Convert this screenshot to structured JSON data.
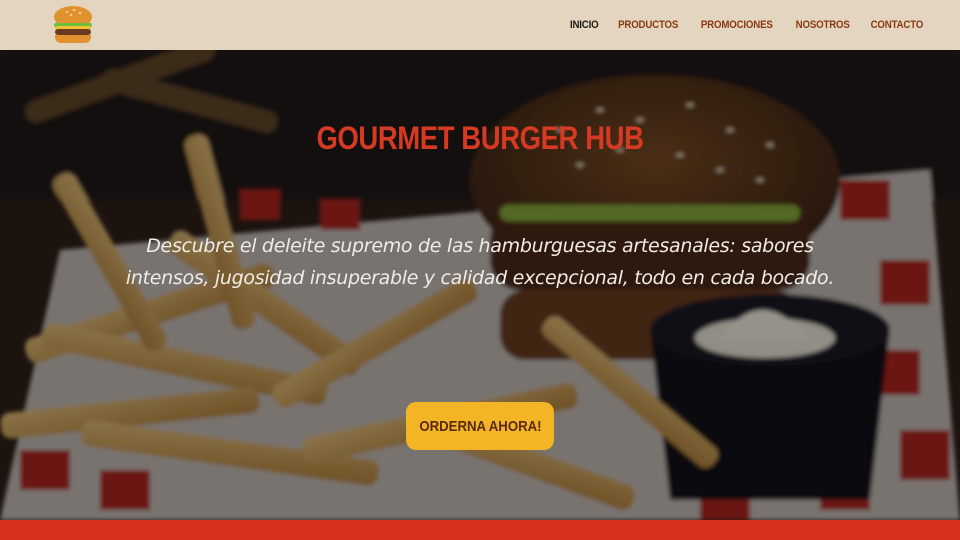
{
  "nav": {
    "logo_icon": "burger-icon",
    "items": [
      {
        "label": "INICIO",
        "active": true
      },
      {
        "label": "PRODUCTOS",
        "active": false
      },
      {
        "label": "PROMOCIONES",
        "active": false
      },
      {
        "label": "NOSOTROS",
        "active": false
      },
      {
        "label": "CONTACTO",
        "active": false
      }
    ]
  },
  "hero": {
    "title": "GOURMET BURGER HUB",
    "description": "Descubre el deleite supremo de las hamburguesas artesanales: sabores intensos, jugosidad insuperable y calidad excepcional, todo en cada bocado.",
    "cta_label": "ORDERNA AHORA!"
  },
  "colors": {
    "nav_bg": "#e4d5c0",
    "nav_text": "#8a3a12",
    "title": "#d63a22",
    "cta_bg": "#f3b526",
    "accent_bar": "#d8321f"
  }
}
